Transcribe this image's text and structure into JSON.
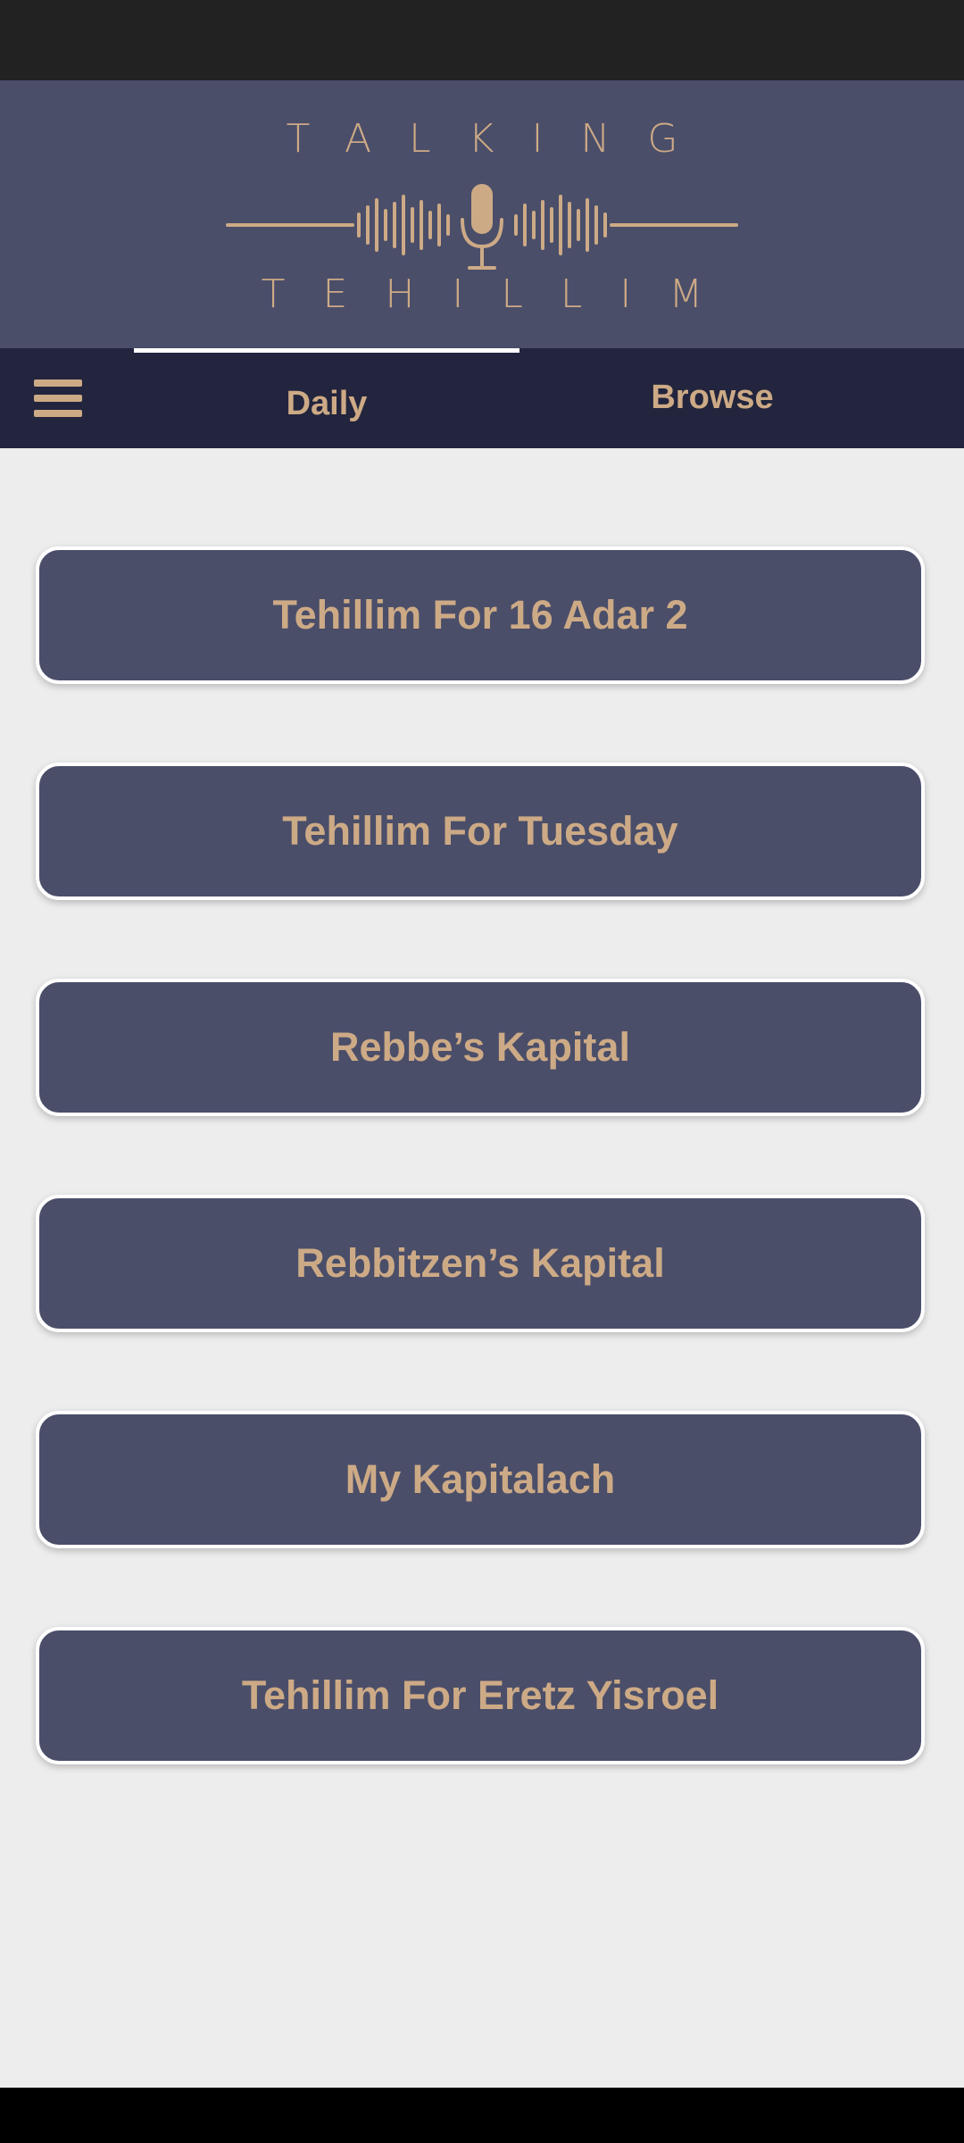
{
  "app": {
    "logo_line1": "TALKING",
    "logo_line2": "TEHILLIM",
    "accent_color": "#cdaa86",
    "header_color": "#4a4e69",
    "tabbar_color": "#22253d"
  },
  "nav": {
    "menu_icon": "hamburger-menu-icon",
    "tabs": [
      {
        "label": "Daily",
        "selected": true
      },
      {
        "label": "Browse",
        "selected": false
      }
    ]
  },
  "menu": {
    "items": [
      {
        "label": "Tehillim For 16 Adar 2"
      },
      {
        "label": "Tehillim For Tuesday"
      },
      {
        "label": "Rebbe’s Kapital"
      },
      {
        "label": "Rebbitzen’s Kapital"
      },
      {
        "label": "My Kapitalach"
      },
      {
        "label": "Tehillim For Eretz Yisroel"
      }
    ]
  }
}
